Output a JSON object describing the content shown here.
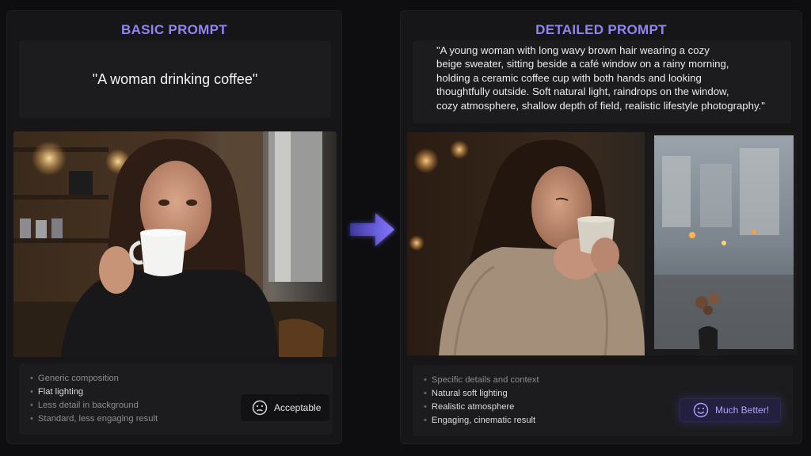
{
  "basic": {
    "heading": "BASIC PROMPT",
    "prompt": "\"A woman drinking coffee\"",
    "points": [
      "Generic composition",
      "Flat lighting",
      "Less detail in background",
      "Standard, less engaging result"
    ],
    "badge_label": "Acceptable",
    "badge_icon": "neutral-face-icon"
  },
  "detailed": {
    "heading": "DETAILED PROMPT",
    "prompt_lines": [
      "\"A young woman with long wavy brown hair wearing a cozy",
      "beige sweater, sitting beside a café window on a rainy morning,",
      "holding a ceramic coffee cup with both hands and looking",
      "thoughtfully outside. Soft natural light, raindrops on the window,",
      "cozy atmosphere, shallow depth of field, realistic lifestyle photography.\""
    ],
    "points": [
      "Specific details and context",
      "Natural soft lighting",
      "Realistic atmosphere",
      "Engaging, cinematic result"
    ],
    "badge_label": "Much Better!",
    "badge_icon": "smile-face-icon"
  },
  "colors": {
    "accent": "#8f86f2",
    "arrow": "#7b6ef5",
    "background": "#0e0e10",
    "panel": "#161618"
  }
}
